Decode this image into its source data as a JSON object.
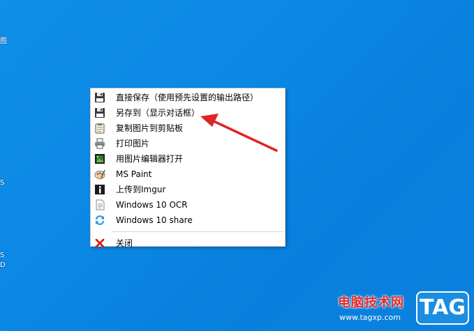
{
  "desktop": {
    "edge_glyphs": [
      "图",
      "S",
      "S",
      "D"
    ]
  },
  "context_menu": {
    "items": [
      {
        "label": "直接保存（使用预先设置的输出路径）",
        "icon": "floppy-disk-icon"
      },
      {
        "label": "另存到（显示对话框）",
        "icon": "floppy-disk-icon"
      },
      {
        "label": "复制图片到剪贴板",
        "icon": "clipboard-icon"
      },
      {
        "label": "打印图片",
        "icon": "printer-icon"
      },
      {
        "label": "用图片编辑器打开",
        "icon": "image-editor-icon"
      },
      {
        "label": "MS Paint",
        "icon": "paint-palette-icon"
      },
      {
        "label": "上传到Imgur",
        "icon": "imgur-info-icon"
      },
      {
        "label": "Windows 10 OCR",
        "icon": "document-icon"
      },
      {
        "label": "Windows 10 share",
        "icon": "share-refresh-icon"
      }
    ],
    "close_item": {
      "label": "关闭",
      "icon": "close-x-icon"
    }
  },
  "annotation": {
    "color": "#e02424"
  },
  "watermark": {
    "site_name": "电脑技术网",
    "url": "www.tagxp.com",
    "badge": "TAG"
  },
  "colors": {
    "desktop_blue": "#0b88e4",
    "menu_bg": "#ffffff",
    "arrow_red": "#e02424"
  }
}
